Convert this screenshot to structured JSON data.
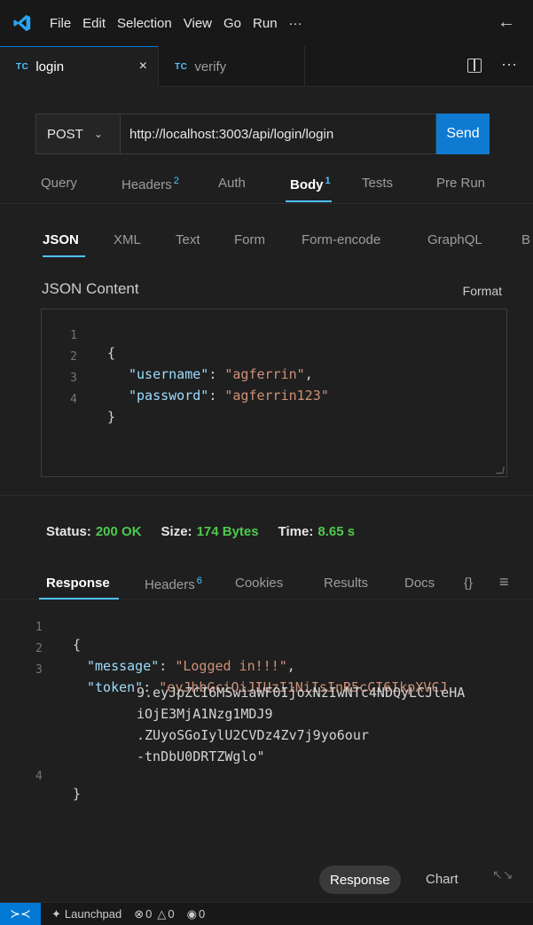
{
  "menu": {
    "items": [
      "File",
      "Edit",
      "Selection",
      "View",
      "Go",
      "Run",
      "···"
    ],
    "back": "←"
  },
  "tabs": [
    {
      "badge": "TC",
      "label": "login",
      "close": "×"
    },
    {
      "badge": "TC",
      "label": "verify"
    }
  ],
  "tab_actions": {
    "more": "···"
  },
  "request": {
    "method": "POST",
    "url": "http://localhost:3003/api/login/login",
    "send_label": "Send"
  },
  "request_tabs": {
    "query": "Query",
    "headers": "Headers",
    "headers_count": "2",
    "auth": "Auth",
    "body": "Body",
    "body_count": "1",
    "tests": "Tests",
    "pre_run": "Pre Run"
  },
  "body_tabs": [
    "JSON",
    "XML",
    "Text",
    "Form",
    "Form-encode",
    "GraphQL",
    "B"
  ],
  "json_content": {
    "label": "JSON Content",
    "format_label": "Format",
    "lines": [
      {
        "n": "1",
        "open": "{"
      },
      {
        "n": "2",
        "key": "\"username\"",
        "sep": ": ",
        "value": "\"agferrin\"",
        "tail": ","
      },
      {
        "n": "3",
        "key": "\"password\"",
        "sep": ": ",
        "value": "\"agferrin123\"",
        "tail": ""
      },
      {
        "n": "4",
        "close": "}"
      }
    ]
  },
  "status": {
    "status_label": "Status:",
    "status_value": "200 OK",
    "size_label": "Size:",
    "size_value": "174 Bytes",
    "time_label": "Time:",
    "time_value": "8.65 s"
  },
  "response_tabs": {
    "response": "Response",
    "headers": "Headers",
    "headers_count": "6",
    "cookies": "Cookies",
    "results": "Results",
    "docs": "Docs",
    "braces": "{}",
    "menu": "≡"
  },
  "response_body": {
    "line1": {
      "n": "1",
      "text": "{"
    },
    "line2": {
      "n": "2",
      "key": "\"message\"",
      "sep": ": ",
      "value": "\"Logged in!!!\"",
      "tail": ","
    },
    "line3": {
      "n": "3",
      "key": "\"token\"",
      "sep": ": ",
      "value": "\"eyJhbGciOiJIUzI1NiIsInR5cCI6IkpXVCJ"
    },
    "wrap1": "9.eyJpZCI6MSwiaWF0IjoxNzIwNTc4NDQyLCJleHA",
    "wrap2": "iOjE3MjA1Nzg1MDJ9",
    "wrap3": ".ZUyoSGoIylU2CVDz4Zv7j9yo6our",
    "wrap4": "-tnDbU0DRTZWglo\"",
    "line4": {
      "n": "4",
      "text": "}"
    }
  },
  "view_pills": {
    "response": "Response",
    "chart": "Chart"
  },
  "statusbar": {
    "launchpad": "Launchpad",
    "errors": "0",
    "warnings": "0",
    "ports": "0"
  },
  "colors": {
    "accent": "#0078d4",
    "send": "#0e7ad1",
    "ok": "#4ec94e",
    "badge": "#4fc1ff"
  }
}
